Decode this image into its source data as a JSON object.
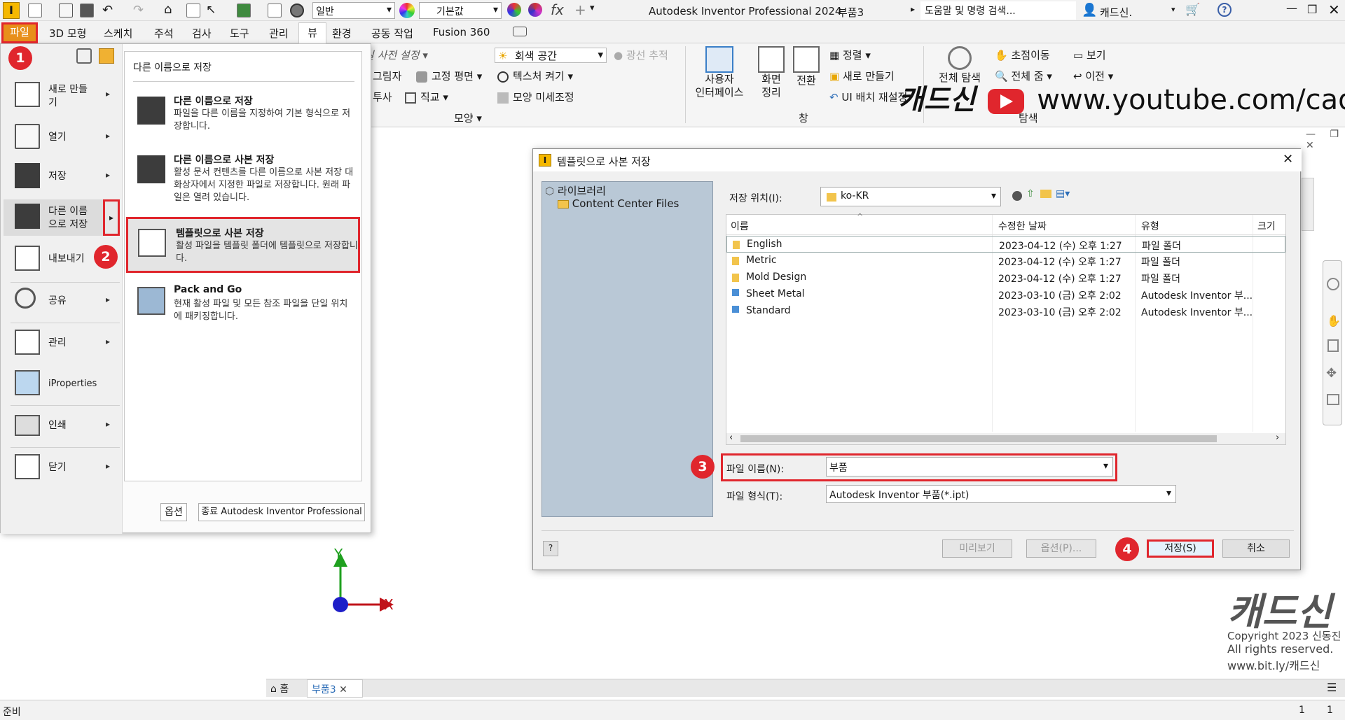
{
  "colors": {
    "accent_red": "#e0262d",
    "app_badge": "#f5b800",
    "lib_pane": "#b9c8d6",
    "file_tab": "#e88f1a"
  },
  "titlebar": {
    "style_select": "일반",
    "appearance_select": "기본값",
    "app_title": "Autodesk Inventor Professional 2024",
    "doc_title": "부품3",
    "search_placeholder": "도움말 및 명령 검색...",
    "user": "캐드신.",
    "help": "?"
  },
  "menubar": {
    "tabs": [
      "파일",
      "3D 모형",
      "스케치",
      "주석",
      "검사",
      "도구",
      "관리",
      "뷰",
      "환경",
      "공동 작업",
      "Fusion 360"
    ]
  },
  "ribbon": {
    "visual_style": "그림자",
    "preset": "실 사전 설정",
    "row2": [
      "그림자",
      "고정 평면",
      "텍스처 켜기"
    ],
    "row3": [
      "투사",
      "직교",
      "모양 미세조정"
    ],
    "gray_space": "회색 공간",
    "ray_trace": "광선 추적",
    "group_appearance": "모양",
    "ui_btn": "사용자\n인터페이스",
    "screen_btn": "화면\n정리",
    "switch_btn": "전환",
    "arrange": "정렬",
    "new_window": "새로 만들기",
    "ui_layout": "UI 배치 재설정",
    "group_window": "창",
    "full_nav": "전체 탐색",
    "pan": "초점이동",
    "zoom_all": "전체 줌",
    "view": "보기",
    "prev": "이전",
    "group_nav": "탐색"
  },
  "filemenu": {
    "items": [
      {
        "label": "새로 만들\n기",
        "icon": "new-file-icon"
      },
      {
        "label": "열기",
        "icon": "open-folder-icon"
      },
      {
        "label": "저장",
        "icon": "save-icon"
      },
      {
        "label": "다른 이름\n으로 저장",
        "icon": "save-as-icon"
      },
      {
        "label": "내보내기",
        "icon": "export-icon"
      },
      {
        "label": "공유",
        "icon": "share-icon"
      },
      {
        "label": "관리",
        "icon": "manage-icon"
      },
      {
        "label": "iProperties",
        "icon": "iproperties-icon"
      },
      {
        "label": "인쇄",
        "icon": "print-icon"
      },
      {
        "label": "닫기",
        "icon": "close-doc-icon"
      }
    ],
    "submenu_title": "다른 이름으로 저장",
    "submenu": [
      {
        "title": "다른 이름으로 저장",
        "desc": "파일을 다른 이름을 지정하여 기본 형식으로 저장합니다."
      },
      {
        "title": "다른 이름으로 사본 저장",
        "desc": "활성 문서 컨텐츠를 다른 이름으로 사본 저장 대화상자에서 지정한 파일로 저장합니다. 원래 파일은 열려 있습니다."
      },
      {
        "title": "템플릿으로 사본 저장",
        "desc": "활성 파일을 템플릿 폴더에 템플릿으로 저장합니다."
      },
      {
        "title": "Pack and Go",
        "desc": "현재 활성 파일 및 모든 참조 파일을 단일 위치에 패키징합니다."
      }
    ],
    "options_btn": "옵션",
    "exit_btn": "종료 Autodesk Inventor Professional"
  },
  "badges": [
    "1",
    "2",
    "3",
    "4"
  ],
  "dialog": {
    "title": "템플릿으로 사본 저장",
    "library": "라이브러리",
    "content_center": "Content Center Files",
    "save_in_label": "저장 위치(I):",
    "save_in_value": "ko-KR",
    "columns": [
      "이름",
      "수정한 날짜",
      "유형",
      "크기"
    ],
    "rows": [
      {
        "name": "English",
        "date": "2023-04-12 (수) 오후 1:27",
        "type": "파일 폴더"
      },
      {
        "name": "Metric",
        "date": "2023-04-12 (수) 오후 1:27",
        "type": "파일 폴더"
      },
      {
        "name": "Mold Design",
        "date": "2023-04-12 (수) 오후 1:27",
        "type": "파일 폴더"
      },
      {
        "name": "Sheet Metal",
        "date": "2023-03-10 (금) 오후 2:02",
        "type": "Autodesk Inventor 부..."
      },
      {
        "name": "Standard",
        "date": "2023-03-10 (금) 오후 2:02",
        "type": "Autodesk Inventor 부..."
      }
    ],
    "filename_label": "파일 이름(N):",
    "filename_value": "부품",
    "filetype_label": "파일 형식(T):",
    "filetype_value": "Autodesk Inventor 부품(*.ipt)",
    "preview_btn": "미리보기",
    "options_btn": "옵션(P)...",
    "save_btn": "저장(S)",
    "cancel_btn": "취소",
    "help_btn": "?"
  },
  "workspace": {
    "axis_y": "Y",
    "axis_x": "X",
    "tab_home": "홈",
    "tab_doc": "부품3",
    "status": "준비",
    "status_n1": "1",
    "status_n2": "1"
  },
  "watermark": {
    "channel": "캐드신",
    "url": "www.youtube.com/cadsin",
    "logo": "캐드신",
    "copyright": "Copyright  2023  신동진",
    "rights": "All  rights  reserved.",
    "link": "www.bit.ly/캐드신"
  }
}
